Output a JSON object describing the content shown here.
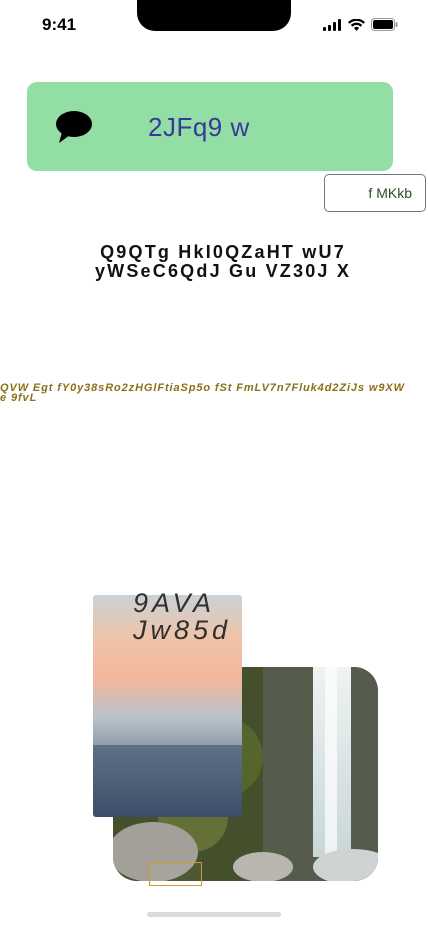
{
  "status_bar": {
    "time": "9:41"
  },
  "banner": {
    "text": "2JFq9 w",
    "icon": "chat-bubble-icon"
  },
  "outline_button": {
    "label": "f MKkb"
  },
  "heading": {
    "text": "Q9QTg HkI0QZaHT wU7 yWSeC6QdJ Gu VZ30J X"
  },
  "olive_text": {
    "text": "QVW Egt fY0y38sRo2zHGlFtiaSp5o  fSt  FmLV7n7Fluk4d2ZiJs w9XW e 9fvL"
  },
  "image_caption": {
    "text": "9AVA Jw85d"
  },
  "colors": {
    "banner_bg": "#93dea5",
    "banner_text": "#3a3899",
    "olive_text": "#8a7017",
    "box_border": "#cf9c2c"
  }
}
